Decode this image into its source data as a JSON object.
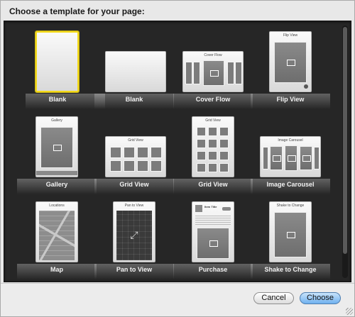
{
  "dialog": {
    "header": "Choose a template for your page:"
  },
  "templates": [
    {
      "label": "Blank",
      "selected": true
    },
    {
      "label": "Blank"
    },
    {
      "label": "Cover Flow",
      "thumb_title": "Cover Flow"
    },
    {
      "label": "Flip View",
      "thumb_title": "Flip View"
    },
    {
      "label": "Gallery",
      "thumb_title": "Gallery"
    },
    {
      "label": "Grid View",
      "thumb_title": "Grid View"
    },
    {
      "label": "Grid View",
      "thumb_title": "Grid View"
    },
    {
      "label": "Image Carousel",
      "thumb_title": "Image Carousel"
    },
    {
      "label": "Map",
      "thumb_title": "Locations"
    },
    {
      "label": "Pan to View",
      "thumb_title": "Pan to View"
    },
    {
      "label": "Purchase",
      "thumb_title": "Item Title"
    },
    {
      "label": "Shake to Change",
      "thumb_title": "Shake to Change"
    }
  ],
  "buttons": {
    "cancel": "Cancel",
    "choose": "Choose"
  },
  "colors": {
    "selection": "#f3da1b",
    "primary_button": "#6fb1ef",
    "chooser_bg": "#262626"
  }
}
